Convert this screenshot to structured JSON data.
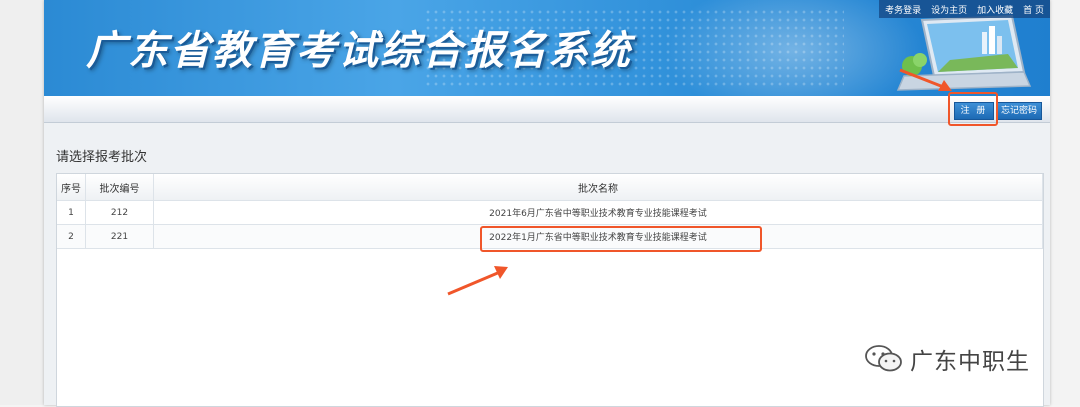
{
  "header": {
    "title": "广东省教育考试综合报名系统",
    "links": [
      "考务登录",
      "设为主页",
      "加入收藏",
      "首 页"
    ]
  },
  "nav": {
    "register_label": "注 册",
    "forgot_label": "忘记密码"
  },
  "main": {
    "section_title": "请选择报考批次",
    "columns": [
      "序号",
      "批次编号",
      "批次名称"
    ],
    "rows": [
      {
        "idx": "1",
        "no": "212",
        "name": "2021年6月广东省中等职业技术教育专业技能课程考试"
      },
      {
        "idx": "2",
        "no": "221",
        "name": "2022年1月广东省中等职业技术教育专业技能课程考试"
      }
    ]
  },
  "watermark": {
    "text": "广东中职生",
    "icon": "wechat-icon"
  },
  "colors": {
    "banner": "#2e8fd9",
    "highlight": "#f0562a",
    "button": "#1d6ab4"
  }
}
